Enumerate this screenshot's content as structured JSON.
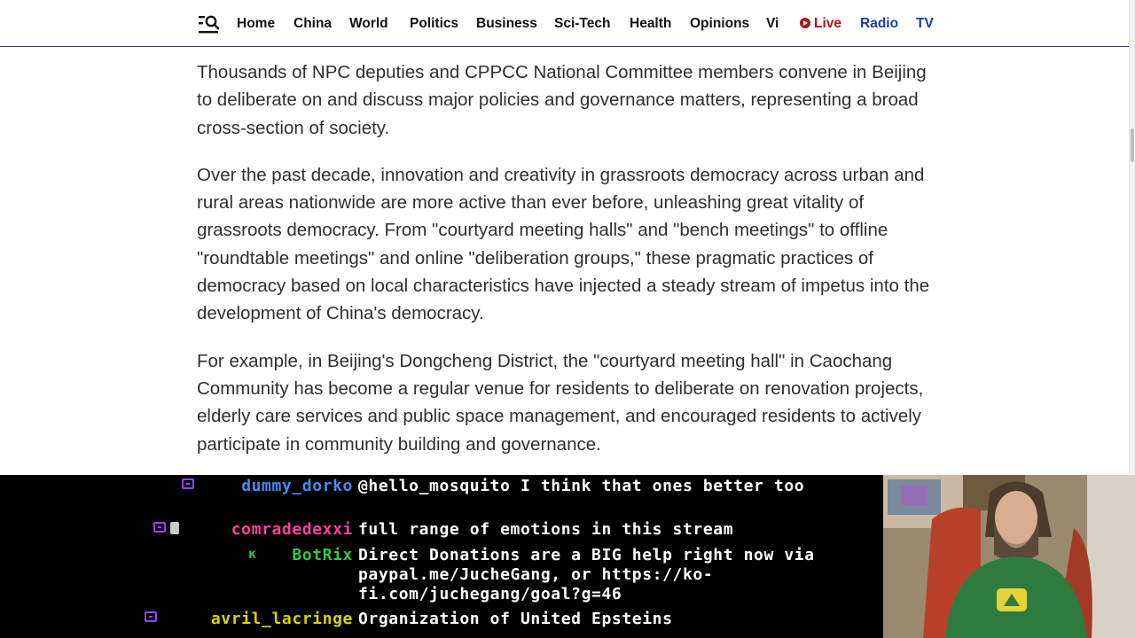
{
  "nav": {
    "items": [
      {
        "label": "Home"
      },
      {
        "label": "China"
      },
      {
        "label": "World"
      },
      {
        "label": "Politics"
      },
      {
        "label": "Business"
      },
      {
        "label": "Sci-Tech"
      },
      {
        "label": "Health"
      },
      {
        "label": "Opinions"
      },
      {
        "label": "Vi"
      }
    ],
    "live": "Live",
    "radio": "Radio",
    "tv": "TV"
  },
  "article": {
    "paragraphs": [
      "Thousands of NPC deputies and CPPCC National Committee members convene in Beijing to deliberate on and discuss major policies and governance matters, representing a broad cross-section of society.",
      "Over the past decade, innovation and creativity in grassroots democracy across urban and rural areas nationwide are more active than ever before, unleashing great vitality of grassroots democracy. From \"courtyard meeting halls\" and \"bench meetings\" to offline \"roundtable meetings\" and online \"deliberation groups,\" these pragmatic practices of democracy based on local characteristics have injected a steady stream of impetus into the development of China's democracy.",
      "For example, in Beijing's Dongcheng District, the \"courtyard meeting hall\" in Caochang Community has become a regular venue for residents to deliberate on renovation projects, elderly care services and public space management, and encouraged residents to actively participate in community building and governance."
    ]
  },
  "chat": {
    "messages": [
      {
        "user": "dummy_dorko",
        "color": "#3f8df7",
        "text": "@hello_mosquito I think that ones better too"
      },
      {
        "user": "comradedexxi",
        "color": "#ff3fa5",
        "text": "full range of emotions in this stream"
      },
      {
        "user": "BotRix",
        "color": "#2ec84a",
        "text": "Direct Donations are a BIG help right now via paypal.me/JucheGang, or https://ko-fi.com/juchegang/goal?g=46"
      },
      {
        "user": "avril_lacringe",
        "color": "#d6d400",
        "text": "Organization of United Epsteins"
      }
    ]
  }
}
